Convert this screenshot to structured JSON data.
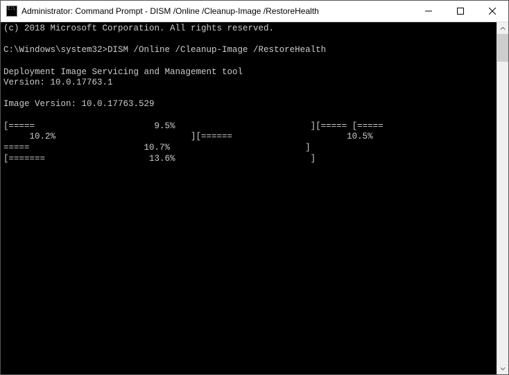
{
  "window": {
    "title": "Administrator: Command Prompt - DISM  /Online /Cleanup-Image /RestoreHealth"
  },
  "terminal": {
    "lines": [
      "(c) 2018 Microsoft Corporation. All rights reserved.",
      "",
      "C:\\Windows\\system32>DISM /Online /Cleanup-Image /RestoreHealth",
      "",
      "Deployment Image Servicing and Management tool",
      "Version: 10.0.17763.1",
      "",
      "Image Version: 10.0.17763.529",
      "",
      "[=====                       9.5%                          ][===== [=====",
      "     10.2%                          ][======                      10.5%                          [=",
      "=====                      10.7%                          ]",
      "[=======                    13.6%                          ]"
    ]
  }
}
